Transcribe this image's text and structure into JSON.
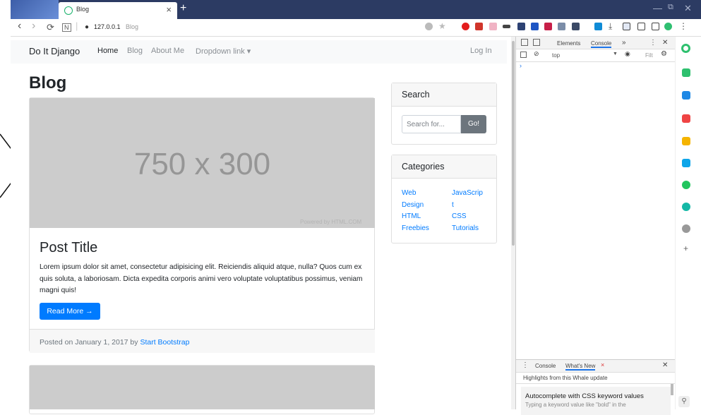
{
  "browser": {
    "tab_title": "Blog",
    "tab_close": "×",
    "new_tab": "+",
    "url_lock": "●",
    "url_host": "127.0.0.1",
    "url_path": "Blog",
    "window_controls": {
      "minimize": "—",
      "restore": "⧉",
      "close": "✕"
    },
    "nav": {
      "back": "‹",
      "forward": "›",
      "reload": "⟳",
      "reader": "N"
    },
    "icons": [
      "whale-logo",
      "back-icon",
      "forward-icon",
      "reload-icon",
      "lock-icon"
    ]
  },
  "site": {
    "brand": "Do It Django",
    "nav": {
      "home": "Home",
      "blog": "Blog",
      "about": "About Me",
      "dropdown": "Dropdown link ▾"
    },
    "login": "Log In",
    "heading": "Blog",
    "post": {
      "image_text": "750 x 300",
      "image_credit": "Powered by HTML.COM",
      "title": "Post Title",
      "excerpt": "Lorem ipsum dolor sit amet, consectetur adipisicing elit. Reiciendis aliquid atque, nulla? Quos cum ex quis soluta, a laboriosam. Dicta expedita corporis animi vero voluptate voluptatibus possimus, veniam magni quis!",
      "read_more": "Read More →",
      "footer_prefix": "Posted on January 1, 2017 by ",
      "footer_author": "Start Bootstrap"
    },
    "search": {
      "title": "Search",
      "placeholder": "Search for...",
      "button": "Go!"
    },
    "categories": {
      "title": "Categories",
      "col1": [
        "Web",
        "Design",
        "HTML",
        "Freebies"
      ],
      "col2": [
        "JavaScrip",
        "t",
        "CSS",
        "Tutorials"
      ]
    }
  },
  "devtools": {
    "tabs": {
      "elements": "Elements",
      "console": "Console",
      "more": "»"
    },
    "context": "top",
    "filter": "Filt",
    "caret": "›",
    "drawer": {
      "menu": "⋮",
      "console": "Console",
      "whats_new": "What's New",
      "whats_new_close": "×",
      "close": "✕",
      "subtitle": "Highlights from this Whale update",
      "item_title": "Autocomplete with CSS keyword values",
      "item_text": "Typing a keyword value like \"bold\" in the"
    }
  },
  "colors": {
    "titlebar": "#2c3b63",
    "primary": "#007bff",
    "secondary": "#6c757d",
    "placeholder_bg": "#cccccc"
  }
}
